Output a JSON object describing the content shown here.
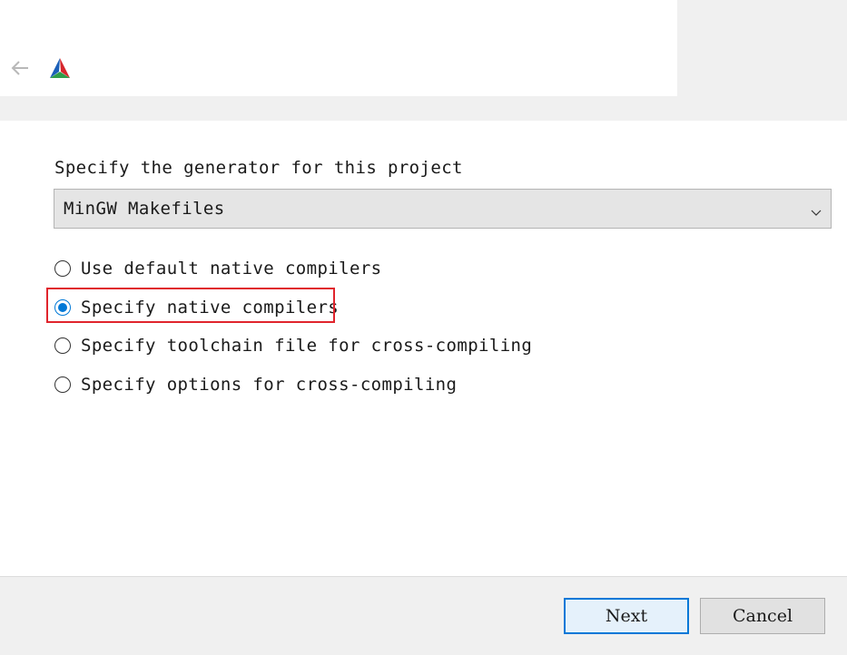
{
  "header": {
    "back_icon": "arrow-left-icon",
    "logo_icon": "cmake-triangle-icon"
  },
  "generator": {
    "label": "Specify the generator for this project",
    "selected": "MinGW Makefiles"
  },
  "compiler_options": [
    {
      "label": "Use default native compilers",
      "checked": false
    },
    {
      "label": "Specify native compilers",
      "checked": true
    },
    {
      "label": "Specify toolchain file for cross-compiling",
      "checked": false
    },
    {
      "label": "Specify options for cross-compiling",
      "checked": false
    }
  ],
  "buttons": {
    "next": "Next",
    "cancel": "Cancel"
  },
  "colors": {
    "accent": "#0078d7",
    "highlight": "#e0242c"
  }
}
